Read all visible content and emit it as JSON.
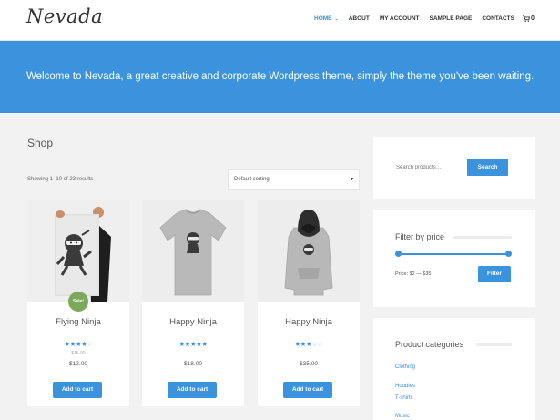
{
  "header": {
    "logo": "Nevada",
    "nav": [
      {
        "label": "HOME",
        "active": true
      },
      {
        "label": "ABOUT"
      },
      {
        "label": "MY ACCOUNT"
      },
      {
        "label": "SAMPLE PAGE"
      },
      {
        "label": "CONTACTS"
      }
    ],
    "cart_count": "0"
  },
  "banner": {
    "text": "Welcome to Nevada, a great creative and corporate Wordpress theme, simply the theme you've been waiting."
  },
  "shop": {
    "title": "Shop",
    "results": "Showing 1–10 of 23 results",
    "sorting": "Default sorting",
    "products": [
      {
        "name": "Flying Ninja",
        "rating": 4,
        "old_price": "$15.00",
        "price": "$12.00",
        "badge": "Sale!",
        "button": "Add to cart"
      },
      {
        "name": "Happy Ninja",
        "rating": 5,
        "price": "$18.00",
        "button": "Add to cart"
      },
      {
        "name": "Happy Ninja",
        "rating": 3,
        "price": "$35.00",
        "button": "Add to cart"
      }
    ]
  },
  "sidebar": {
    "search": {
      "placeholder": "Search products…",
      "button": "Search"
    },
    "filter": {
      "title": "Filter by price",
      "price_label": "Price: $2 — $35",
      "button": "Filter"
    },
    "categories": {
      "title": "Product categories",
      "items": [
        "Clothing",
        "Hoodies",
        "T-shirts",
        "Music"
      ]
    }
  },
  "colors": {
    "accent": "#3a93dc",
    "sale": "#7ca85a",
    "background": "#f2f2f2"
  }
}
